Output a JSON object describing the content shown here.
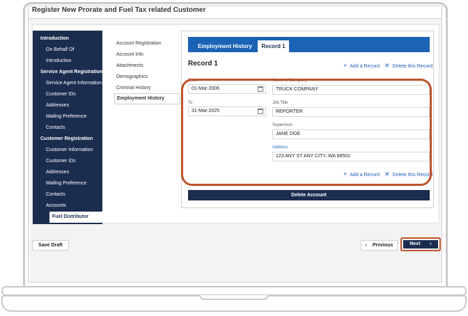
{
  "window": {
    "title": "Register New Prorate and Fuel Tax related Customer"
  },
  "sidebar": {
    "items": [
      {
        "label": "Introduction",
        "kind": "head"
      },
      {
        "label": "On Behalf Of",
        "kind": "sub"
      },
      {
        "label": "Introduction",
        "kind": "sub"
      },
      {
        "label": "Service Agent Registration",
        "kind": "head"
      },
      {
        "label": "Service Agent Information",
        "kind": "sub"
      },
      {
        "label": "Customer IDs",
        "kind": "sub"
      },
      {
        "label": "Addresses",
        "kind": "sub"
      },
      {
        "label": "Mailing Preference",
        "kind": "sub"
      },
      {
        "label": "Contacts",
        "kind": "sub"
      },
      {
        "label": "Customer Registration",
        "kind": "head"
      },
      {
        "label": "Customer Information",
        "kind": "sub"
      },
      {
        "label": "Customer IDs",
        "kind": "sub"
      },
      {
        "label": "Addresses",
        "kind": "sub"
      },
      {
        "label": "Mailing Preference",
        "kind": "sub"
      },
      {
        "label": "Contacts",
        "kind": "sub"
      },
      {
        "label": "Accounts",
        "kind": "sub"
      },
      {
        "label": "Fuel Distributor",
        "kind": "active"
      }
    ]
  },
  "subnav": {
    "items": [
      "Account Registration",
      "Account Info",
      "Attachments",
      "Demographics",
      "Criminal History",
      "Employment History"
    ],
    "active_index": 5
  },
  "panel": {
    "tabs": [
      "Employment History",
      "Record 1"
    ],
    "record_title": "Record 1",
    "add_record": "Add a Record",
    "delete_record": "Delete this Record",
    "fields": {
      "from_label": "From",
      "from_value": "01-Mar-2006",
      "to_label": "To",
      "to_value": "31-Mar-2025",
      "company_label": "Name of Company",
      "company_value": "TRUCK COMPANY",
      "job_label": "Job Title",
      "job_value": "REPORTER",
      "supervisor_label": "Supervisor",
      "supervisor_value": "JANE DOE",
      "address_label": "Address",
      "address_value": "123 ANY ST ANY CITY, WA 98502"
    },
    "delete_account": "Delete Account"
  },
  "footer": {
    "save_draft": "Save Draft",
    "previous": "Previous",
    "next": "Next"
  },
  "icons": {
    "plus": "plus-icon",
    "close": "close-icon",
    "calendar": "calendar-icon",
    "chevron_left": "chevron-left-icon",
    "chevron_right": "chevron-right-icon"
  },
  "colors": {
    "navy": "#1b2d4f",
    "blue": "#1b63b5",
    "highlight": "#c0502a"
  }
}
